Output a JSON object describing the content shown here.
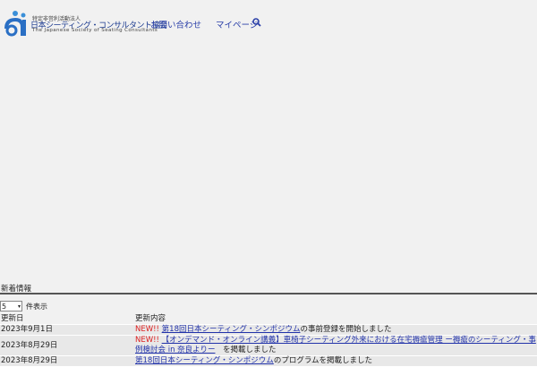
{
  "header": {
    "logo_small": "特定非営利活動法人",
    "logo_name": "日本シーティング・コンサルタント協会",
    "logo_en": "The Japanese Society of Seating Consultants",
    "nav": [
      "お問い合わせ",
      "マイページ"
    ]
  },
  "news": {
    "title": "新着情報",
    "page_size": "5",
    "page_size_suffix": "件表示",
    "columns": [
      "更新日",
      "更新内容"
    ],
    "rows": [
      {
        "date": "2023年9月1日",
        "badge": "NEW!!",
        "link": "第18回日本シーティング・シンポジウム",
        "suffix": "の事前登録を開始しました"
      },
      {
        "date": "2023年8月29日",
        "badge": "NEW!!",
        "link": "【オンデマンド・オンライン講義】車椅子シーティング外来における在宅褥瘡管理 ー褥瘡のシーティング・事例検討会 in 奈良よりー",
        "suffix": "　を掲載しました"
      },
      {
        "date": "2023年8月29日",
        "badge": "",
        "link": "第18回日本シーティング・シンポジウム",
        "suffix": "のプログラムを掲載しました"
      }
    ]
  }
}
